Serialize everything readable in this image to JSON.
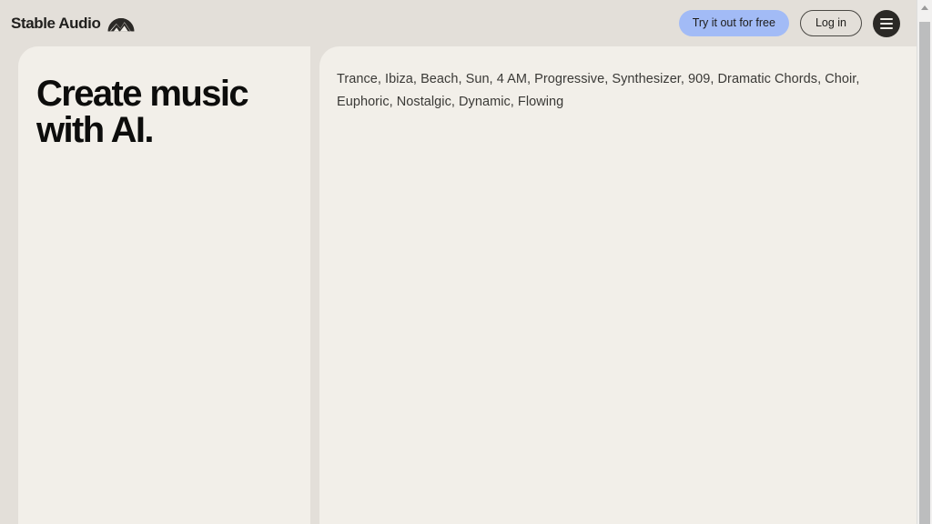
{
  "app": {
    "background_color": "#e3dfd9",
    "panel_color": "#f2efe9"
  },
  "topbar": {
    "brand": {
      "wordmark": "Stable Audio",
      "logo_icon": "stable-audio-dome-icon"
    },
    "try_button": {
      "label": "Try it out for free",
      "background_color": "#a2bbf6",
      "text_color": "#1d1c1a"
    },
    "login_button": {
      "label": "Log in",
      "border_color": "#4a4844",
      "text_color": "#21201e"
    },
    "menu_button": {
      "icon": "hamburger-menu-icon",
      "background_color": "#2b2926"
    }
  },
  "main": {
    "left_panel": {
      "heading": "Create music\nwith AI."
    },
    "right_panel": {
      "tags_text": "Trance, Ibiza, Beach, Sun, 4 AM, Progressive, Synthesizer, 909, Dramatic Chords, Choir, Euphoric, Nostalgic, Dynamic, Flowing",
      "tags": [
        "Trance",
        "Ibiza",
        "Beach",
        "Sun",
        "4 AM",
        "Progressive",
        "Synthesizer",
        "909",
        "Dramatic Chords",
        "Choir",
        "Euphoric",
        "Nostalgic",
        "Dynamic",
        "Flowing"
      ]
    }
  },
  "scrollbar": {
    "up_arrow_icon": "caret-up-icon",
    "thumb_color": "#bcbdbe",
    "track_color": "#f2f1f0"
  }
}
